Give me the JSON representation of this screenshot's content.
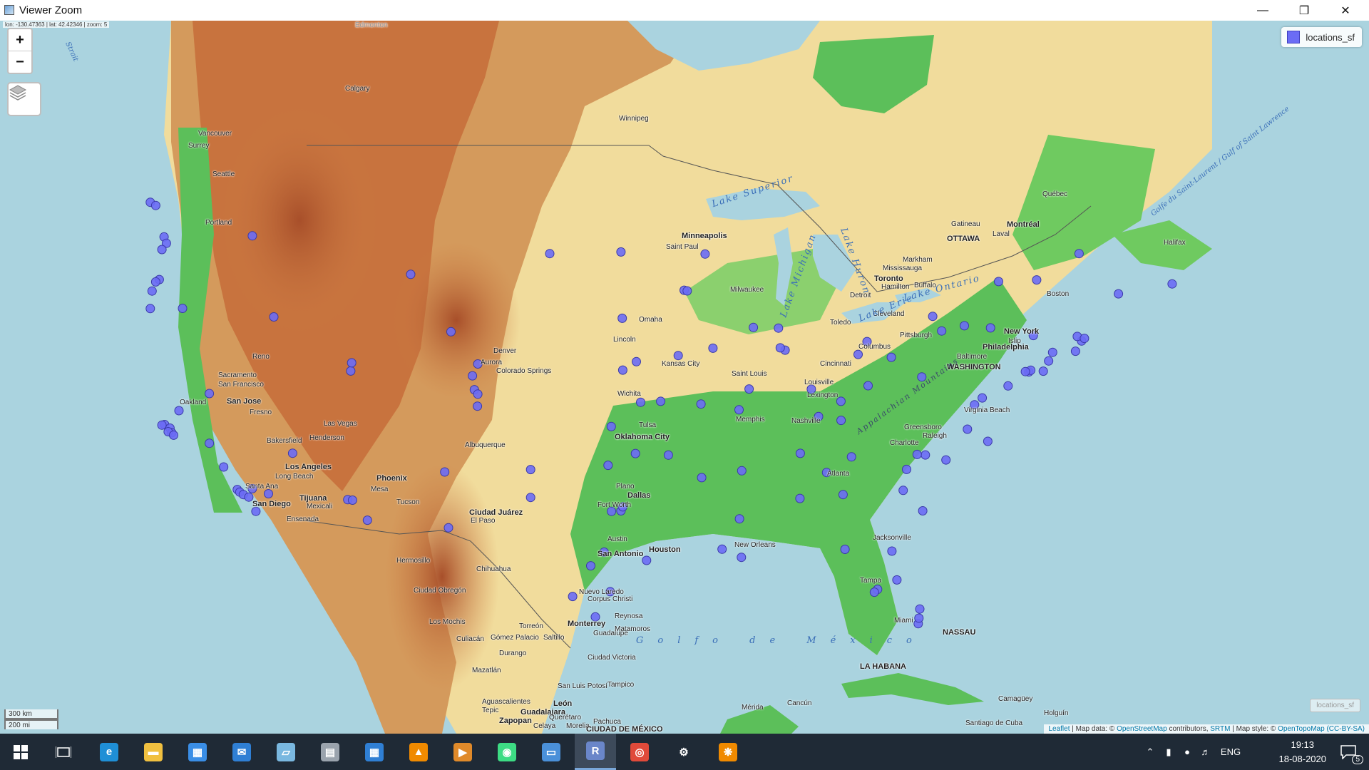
{
  "window": {
    "title": "Viewer Zoom",
    "minimize_icon": "minimize-icon",
    "restore_icon": "restore-icon",
    "close_icon": "close-icon"
  },
  "map": {
    "coordinate_readout": "lon: -130.47363 | lat: 42.42346 | zoom: 5",
    "zoom_in_label": "+",
    "zoom_out_label": "−",
    "layers_icon": "layers-icon",
    "legend": {
      "label": "locations_sf",
      "color": "#6b6cf5"
    },
    "scale": {
      "km": "300 km",
      "mi": "200 mi"
    },
    "minimap_label": "locations_sf",
    "attribution": {
      "leaflet": "Leaflet",
      "map_data_prefix": " | Map data: © ",
      "osm": "OpenStreetMap",
      "contributors": " contributors, ",
      "srtm": "SRTM",
      "style_prefix": " | Map style: © ",
      "otm": "OpenTopoMap",
      "license": "(CC-BY-SA)"
    },
    "colors": {
      "water": "#aad3df",
      "lowland": "#5cbf5a",
      "plains": "#f1dc9c",
      "mountains": "#c8733e",
      "highland": "#9b4a2b",
      "point": "#6b6cf5"
    },
    "cities": [
      {
        "name": "Edmonton"
      },
      {
        "name": "Calgary"
      },
      {
        "name": "Winnipeg"
      },
      {
        "name": "Vancouver"
      },
      {
        "name": "Surrey"
      },
      {
        "name": "Seattle"
      },
      {
        "name": "Portland"
      },
      {
        "name": "Minneapolis"
      },
      {
        "name": "Saint Paul"
      },
      {
        "name": "Milwaukee"
      },
      {
        "name": "Detroit"
      },
      {
        "name": "Toronto"
      },
      {
        "name": "Markham"
      },
      {
        "name": "Mississauga"
      },
      {
        "name": "Hamilton"
      },
      {
        "name": "Buffalo"
      },
      {
        "name": "Cleveland"
      },
      {
        "name": "Toledo"
      },
      {
        "name": "Columbus"
      },
      {
        "name": "Pittsburgh"
      },
      {
        "name": "OTTAWA"
      },
      {
        "name": "Montréal"
      },
      {
        "name": "Gatineau"
      },
      {
        "name": "Laval"
      },
      {
        "name": "Québec"
      },
      {
        "name": "Halifax"
      },
      {
        "name": "Boston"
      },
      {
        "name": "New York"
      },
      {
        "name": "Islip"
      },
      {
        "name": "Philadelphia"
      },
      {
        "name": "WASHINGTON"
      },
      {
        "name": "Baltimore"
      },
      {
        "name": "Virginia Beach"
      },
      {
        "name": "Greensboro"
      },
      {
        "name": "Raleigh"
      },
      {
        "name": "Charlotte"
      },
      {
        "name": "Atlanta"
      },
      {
        "name": "Jacksonville"
      },
      {
        "name": "Tampa"
      },
      {
        "name": "Miami"
      },
      {
        "name": "NASSAU"
      },
      {
        "name": "LA HABANA"
      },
      {
        "name": "Camagüey"
      },
      {
        "name": "Holguín"
      },
      {
        "name": "Santiago de Cuba"
      },
      {
        "name": "Omaha"
      },
      {
        "name": "Lincoln"
      },
      {
        "name": "Kansas City"
      },
      {
        "name": "Saint Louis"
      },
      {
        "name": "Wichita"
      },
      {
        "name": "Louisville"
      },
      {
        "name": "Lexington"
      },
      {
        "name": "Cincinnati"
      },
      {
        "name": "Nashville"
      },
      {
        "name": "Memphis"
      },
      {
        "name": "Tulsa"
      },
      {
        "name": "Oklahoma City"
      },
      {
        "name": "Plano"
      },
      {
        "name": "Dallas"
      },
      {
        "name": "Fort Worth"
      },
      {
        "name": "Austin"
      },
      {
        "name": "San Antonio"
      },
      {
        "name": "Houston"
      },
      {
        "name": "New Orleans"
      },
      {
        "name": "Denver"
      },
      {
        "name": "Aurora"
      },
      {
        "name": "Colorado Springs"
      },
      {
        "name": "Albuquerque"
      },
      {
        "name": "Reno"
      },
      {
        "name": "Sacramento"
      },
      {
        "name": "San Francisco"
      },
      {
        "name": "Oakland"
      },
      {
        "name": "San Jose"
      },
      {
        "name": "Fresno"
      },
      {
        "name": "Bakersfield"
      },
      {
        "name": "Las Vegas"
      },
      {
        "name": "Henderson"
      },
      {
        "name": "Los Angeles"
      },
      {
        "name": "Long Beach"
      },
      {
        "name": "Santa Ana"
      },
      {
        "name": "San Diego"
      },
      {
        "name": "Tijuana"
      },
      {
        "name": "Mexicali"
      },
      {
        "name": "Ensenada"
      },
      {
        "name": "Phoenix"
      },
      {
        "name": "Mesa"
      },
      {
        "name": "Tucson"
      },
      {
        "name": "Ciudad Juárez"
      },
      {
        "name": "El Paso"
      },
      {
        "name": "Hermosillo"
      },
      {
        "name": "Chihuahua"
      },
      {
        "name": "Ciudad Obregón"
      },
      {
        "name": "Los Mochis"
      },
      {
        "name": "Culiacán"
      },
      {
        "name": "Mazatlán"
      },
      {
        "name": "Durango"
      },
      {
        "name": "Torreón"
      },
      {
        "name": "Gómez Palacio"
      },
      {
        "name": "Saltillo"
      },
      {
        "name": "Monterrey"
      },
      {
        "name": "Guadalupe"
      },
      {
        "name": "Reynosa"
      },
      {
        "name": "Matamoros"
      },
      {
        "name": "Nuevo Laredo"
      },
      {
        "name": "Corpus Christi"
      },
      {
        "name": "Ciudad Victoria"
      },
      {
        "name": "Tampico"
      },
      {
        "name": "San Luis Potosí"
      },
      {
        "name": "Aguascalientes"
      },
      {
        "name": "León"
      },
      {
        "name": "Tepic"
      },
      {
        "name": "Guadalajara"
      },
      {
        "name": "Zapopan"
      },
      {
        "name": "Celaya"
      },
      {
        "name": "Morelia"
      },
      {
        "name": "Querétaro"
      },
      {
        "name": "Pachuca"
      },
      {
        "name": "CIUDAD DE MÉXICO"
      },
      {
        "name": "Mérida"
      },
      {
        "name": "Cancún"
      }
    ],
    "water_labels": [
      {
        "name": "Lake Superior"
      },
      {
        "name": "Lake Michigan"
      },
      {
        "name": "Lake Huron"
      },
      {
        "name": "Lake Ontario"
      },
      {
        "name": "Lake Erie"
      },
      {
        "name": "Golfo de México"
      },
      {
        "name": "Golfe du Saint-Laurent / Gulf of Saint Lawrence"
      },
      {
        "name": "Appalachian Mountains"
      },
      {
        "name": "Strait"
      }
    ],
    "points": [
      {
        "lon": -122.33,
        "lat": 47.61
      },
      {
        "lon": -122.2,
        "lat": 47.3
      },
      {
        "lon": -122.45,
        "lat": 47.0
      },
      {
        "lon": -122.6,
        "lat": 45.52
      },
      {
        "lon": -122.8,
        "lat": 45.4
      },
      {
        "lon": -123.0,
        "lat": 44.94
      },
      {
        "lon": -123.1,
        "lat": 44.05
      },
      {
        "lon": -117.4,
        "lat": 47.66
      },
      {
        "lon": -116.2,
        "lat": 43.62
      },
      {
        "lon": -121.3,
        "lat": 44.06
      },
      {
        "lon": -122.3,
        "lat": 37.8
      },
      {
        "lon": -122.0,
        "lat": 37.6
      },
      {
        "lon": -121.9,
        "lat": 37.34
      },
      {
        "lon": -121.5,
        "lat": 38.58
      },
      {
        "lon": -122.45,
        "lat": 37.77
      },
      {
        "lon": -122.1,
        "lat": 37.4
      },
      {
        "lon": -121.8,
        "lat": 37.2
      },
      {
        "lon": -119.8,
        "lat": 36.74
      },
      {
        "lon": -119.0,
        "lat": 35.37
      },
      {
        "lon": -118.24,
        "lat": 34.05
      },
      {
        "lon": -118.1,
        "lat": 33.9
      },
      {
        "lon": -117.9,
        "lat": 33.75
      },
      {
        "lon": -117.6,
        "lat": 33.6
      },
      {
        "lon": -117.2,
        "lat": 32.75
      },
      {
        "lon": -117.4,
        "lat": 34.1
      },
      {
        "lon": -116.5,
        "lat": 33.8
      },
      {
        "lon": -115.15,
        "lat": 36.17
      },
      {
        "lon": -119.8,
        "lat": 39.53
      },
      {
        "lon": -112.07,
        "lat": 33.45
      },
      {
        "lon": -111.8,
        "lat": 33.42
      },
      {
        "lon": -110.97,
        "lat": 32.22
      },
      {
        "lon": -111.9,
        "lat": 40.76
      },
      {
        "lon": -111.85,
        "lat": 41.2
      },
      {
        "lon": -104.99,
        "lat": 39.74
      },
      {
        "lon": -104.8,
        "lat": 39.5
      },
      {
        "lon": -104.82,
        "lat": 38.83
      },
      {
        "lon": -105.1,
        "lat": 40.5
      },
      {
        "lon": -106.65,
        "lat": 35.08
      },
      {
        "lon": -106.44,
        "lat": 31.76
      },
      {
        "lon": -108.55,
        "lat": 45.78
      },
      {
        "lon": -106.3,
        "lat": 42.85
      },
      {
        "lon": -104.8,
        "lat": 41.14
      },
      {
        "lon": -100.78,
        "lat": 46.8
      },
      {
        "lon": -96.8,
        "lat": 46.88
      },
      {
        "lon": -96.73,
        "lat": 43.55
      },
      {
        "lon": -93.27,
        "lat": 44.98
      },
      {
        "lon": -93.1,
        "lat": 44.95
      },
      {
        "lon": -92.1,
        "lat": 46.78
      },
      {
        "lon": -95.94,
        "lat": 41.26
      },
      {
        "lon": -96.7,
        "lat": 40.81
      },
      {
        "lon": -93.6,
        "lat": 41.59
      },
      {
        "lon": -91.66,
        "lat": 41.98
      },
      {
        "lon": -94.58,
        "lat": 39.1
      },
      {
        "lon": -97.34,
        "lat": 37.69
      },
      {
        "lon": -95.7,
        "lat": 39.05
      },
      {
        "lon": -90.2,
        "lat": 38.63
      },
      {
        "lon": -92.33,
        "lat": 38.95
      },
      {
        "lon": -89.64,
        "lat": 39.78
      },
      {
        "lon": -87.63,
        "lat": 41.88
      },
      {
        "lon": -87.9,
        "lat": 42.0
      },
      {
        "lon": -88.0,
        "lat": 43.04
      },
      {
        "lon": -89.4,
        "lat": 43.07
      },
      {
        "lon": -83.05,
        "lat": 42.33
      },
      {
        "lon": -83.55,
        "lat": 41.65
      },
      {
        "lon": -81.69,
        "lat": 41.5
      },
      {
        "lon": -82.99,
        "lat": 39.96
      },
      {
        "lon": -84.51,
        "lat": 39.1
      },
      {
        "lon": -86.16,
        "lat": 39.77
      },
      {
        "lon": -85.76,
        "lat": 38.25
      },
      {
        "lon": -84.5,
        "lat": 38.04
      },
      {
        "lon": -86.78,
        "lat": 36.16
      },
      {
        "lon": -90.05,
        "lat": 35.15
      },
      {
        "lon": -85.31,
        "lat": 35.05
      },
      {
        "lon": -83.92,
        "lat": 35.96
      },
      {
        "lon": -84.39,
        "lat": 33.75
      },
      {
        "lon": -86.8,
        "lat": 33.52
      },
      {
        "lon": -90.18,
        "lat": 32.3
      },
      {
        "lon": -90.07,
        "lat": 29.95
      },
      {
        "lon": -91.15,
        "lat": 30.45
      },
      {
        "lon": -95.37,
        "lat": 29.76
      },
      {
        "lon": -97.74,
        "lat": 30.27
      },
      {
        "lon": -98.49,
        "lat": 29.42
      },
      {
        "lon": -96.8,
        "lat": 32.78
      },
      {
        "lon": -97.33,
        "lat": 32.75
      },
      {
        "lon": -96.7,
        "lat": 33.02
      },
      {
        "lon": -97.52,
        "lat": 35.47
      },
      {
        "lon": -95.99,
        "lat": 36.15
      },
      {
        "lon": -101.85,
        "lat": 35.22
      },
      {
        "lon": -101.85,
        "lat": 33.58
      },
      {
        "lon": -97.4,
        "lat": 27.8
      },
      {
        "lon": -99.5,
        "lat": 27.5
      },
      {
        "lon": -98.23,
        "lat": 26.2
      },
      {
        "lon": -92.29,
        "lat": 34.75
      },
      {
        "lon": -94.15,
        "lat": 36.06
      },
      {
        "lon": -80.19,
        "lat": 25.76
      },
      {
        "lon": -80.15,
        "lat": 26.12
      },
      {
        "lon": -80.1,
        "lat": 26.7
      },
      {
        "lon": -82.46,
        "lat": 27.95
      },
      {
        "lon": -82.64,
        "lat": 27.77
      },
      {
        "lon": -81.38,
        "lat": 28.54
      },
      {
        "lon": -81.66,
        "lat": 30.33
      },
      {
        "lon": -84.28,
        "lat": 30.44
      },
      {
        "lon": -80.84,
        "lat": 35.23
      },
      {
        "lon": -78.64,
        "lat": 35.78
      },
      {
        "lon": -79.79,
        "lat": 36.07
      },
      {
        "lon": -80.25,
        "lat": 36.1
      },
      {
        "lon": -79.94,
        "lat": 32.78
      },
      {
        "lon": -81.03,
        "lat": 34.0
      },
      {
        "lon": -77.44,
        "lat": 37.54
      },
      {
        "lon": -76.3,
        "lat": 36.85
      },
      {
        "lon": -77.04,
        "lat": 38.91
      },
      {
        "lon": -76.61,
        "lat": 39.29
      },
      {
        "lon": -75.17,
        "lat": 39.95
      },
      {
        "lon": -74.01,
        "lat": 40.71
      },
      {
        "lon": -73.9,
        "lat": 40.8
      },
      {
        "lon": -73.2,
        "lat": 40.75
      },
      {
        "lon": -74.2,
        "lat": 40.73
      },
      {
        "lon": -72.9,
        "lat": 41.3
      },
      {
        "lon": -72.68,
        "lat": 41.76
      },
      {
        "lon": -71.06,
        "lat": 42.36
      },
      {
        "lon": -71.4,
        "lat": 41.82
      },
      {
        "lon": -71.3,
        "lat": 42.6
      },
      {
        "lon": -70.9,
        "lat": 42.5
      },
      {
        "lon": -73.76,
        "lat": 42.65
      },
      {
        "lon": -76.15,
        "lat": 43.05
      },
      {
        "lon": -77.61,
        "lat": 43.16
      },
      {
        "lon": -78.88,
        "lat": 42.89
      },
      {
        "lon": -79.99,
        "lat": 40.44
      },
      {
        "lon": -79.38,
        "lat": 43.65
      },
      {
        "lon": -75.7,
        "lat": 45.42
      },
      {
        "lon": -73.57,
        "lat": 45.5
      },
      {
        "lon": -71.2,
        "lat": 46.8
      },
      {
        "lon": -69.0,
        "lat": 44.8
      },
      {
        "lon": -66.0,
        "lat": 45.3
      },
      {
        "lon": -123.1,
        "lat": 49.25
      },
      {
        "lon": -122.8,
        "lat": 49.1
      }
    ]
  },
  "taskbar": {
    "start_icon": "windows-start-icon",
    "task_view_icon": "task-view-icon",
    "apps": [
      {
        "name": "edge-icon",
        "label": "e",
        "color": "#1f8fd6"
      },
      {
        "name": "file-explorer-icon",
        "label": "▬",
        "color": "#f0c040"
      },
      {
        "name": "store-icon",
        "label": "▦",
        "color": "#3a8ee6"
      },
      {
        "name": "mail-icon",
        "label": "✉",
        "color": "#2f7fd4"
      },
      {
        "name": "notes-icon",
        "label": "▱",
        "color": "#7ab8e0"
      },
      {
        "name": "calculator-icon",
        "label": "▤",
        "color": "#9aa3ad"
      },
      {
        "name": "calendar-icon",
        "label": "▦",
        "color": "#2f7fd4"
      },
      {
        "name": "vlc-icon",
        "label": "▲",
        "color": "#f08a00"
      },
      {
        "name": "media-player-icon",
        "label": "▶",
        "color": "#e08a2a"
      },
      {
        "name": "android-studio-icon",
        "label": "◉",
        "color": "#3ddc84"
      },
      {
        "name": "remote-desktop-icon",
        "label": "▭",
        "color": "#4a90d9"
      },
      {
        "name": "r-icon",
        "label": "R",
        "color": "#6a86c9"
      },
      {
        "name": "chrome-icon",
        "label": "◎",
        "color": "#e04a3a"
      },
      {
        "name": "settings-icon",
        "label": "⚙",
        "color": "#1f2a36"
      },
      {
        "name": "tamil-app-icon",
        "label": "❋",
        "color": "#f08a00"
      }
    ],
    "active_app": "r-icon",
    "tray": {
      "chevron_icon": "chevron-up-icon",
      "battery_icon": "battery-icon",
      "wifi_icon": "wifi-icon",
      "volume_icon": "volume-icon",
      "language": "ENG",
      "time": "19:13",
      "date": "18-08-2020",
      "notification_icon": "notification-icon",
      "notification_count": "5"
    }
  }
}
